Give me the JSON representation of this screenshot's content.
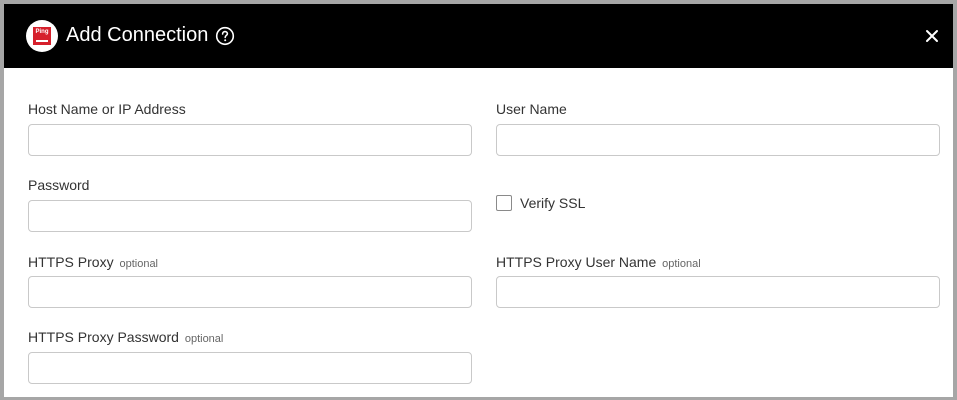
{
  "dialog": {
    "title": "Add Connection",
    "logo_text": "Ping",
    "icons": {
      "help": "help-circle-icon",
      "close": "close-icon"
    }
  },
  "colors": {
    "header_bg": "#000000",
    "header_text": "#ffffff",
    "logo_red": "#d6202c",
    "border": "#a6a6a6",
    "input_border": "#c9c9c9"
  },
  "form": {
    "host": {
      "label": "Host Name or IP Address",
      "value": ""
    },
    "username": {
      "label": "User Name",
      "value": ""
    },
    "password": {
      "label": "Password",
      "value": ""
    },
    "verify_ssl": {
      "label": "Verify SSL",
      "checked": false
    },
    "https_proxy": {
      "label": "HTTPS Proxy",
      "optional": "optional",
      "value": ""
    },
    "https_proxy_user": {
      "label": "HTTPS Proxy User Name",
      "optional": "optional",
      "value": ""
    },
    "https_proxy_password": {
      "label": "HTTPS Proxy Password",
      "optional": "optional",
      "value": ""
    }
  }
}
